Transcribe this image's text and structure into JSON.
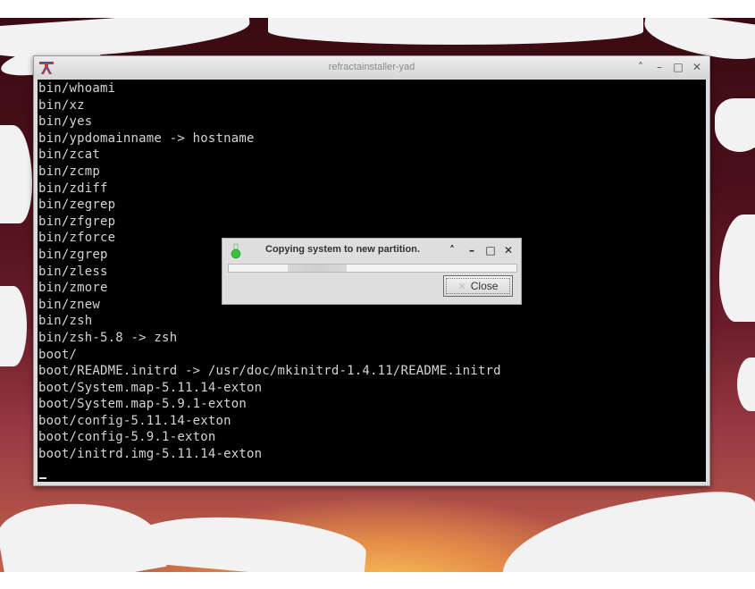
{
  "window": {
    "title": "refractainstaller-yad",
    "controls": {
      "shade": "˄",
      "minimize": "–",
      "maximize": "□",
      "close": "✕"
    }
  },
  "terminal": {
    "lines": [
      "bin/whoami",
      "bin/xz",
      "bin/yes",
      "bin/ypdomainname -> hostname",
      "bin/zcat",
      "bin/zcmp",
      "bin/zdiff",
      "bin/zegrep",
      "bin/zfgrep",
      "bin/zforce",
      "bin/zgrep",
      "bin/zless",
      "bin/zmore",
      "bin/znew",
      "bin/zsh",
      "bin/zsh-5.8 -> zsh",
      "boot/",
      "boot/README.initrd -> /usr/doc/mkinitrd-1.4.11/README.initrd",
      "boot/System.map-5.11.14-exton",
      "boot/System.map-5.9.1-exton",
      "boot/config-5.11.14-exton",
      "boot/config-5.9.1-exton",
      "boot/initrd.img-5.11.14-exton"
    ]
  },
  "dialog": {
    "title": "Copying system to new partition.",
    "close_label": "Close",
    "controls": {
      "shade": "˄",
      "minimize": "–",
      "maximize": "□",
      "close": "✕"
    },
    "progress_mode": "pulsing"
  },
  "colors": {
    "terminal_bg": "#000000",
    "terminal_fg": "#d4d4d4",
    "dialog_bg": "#dedede"
  }
}
